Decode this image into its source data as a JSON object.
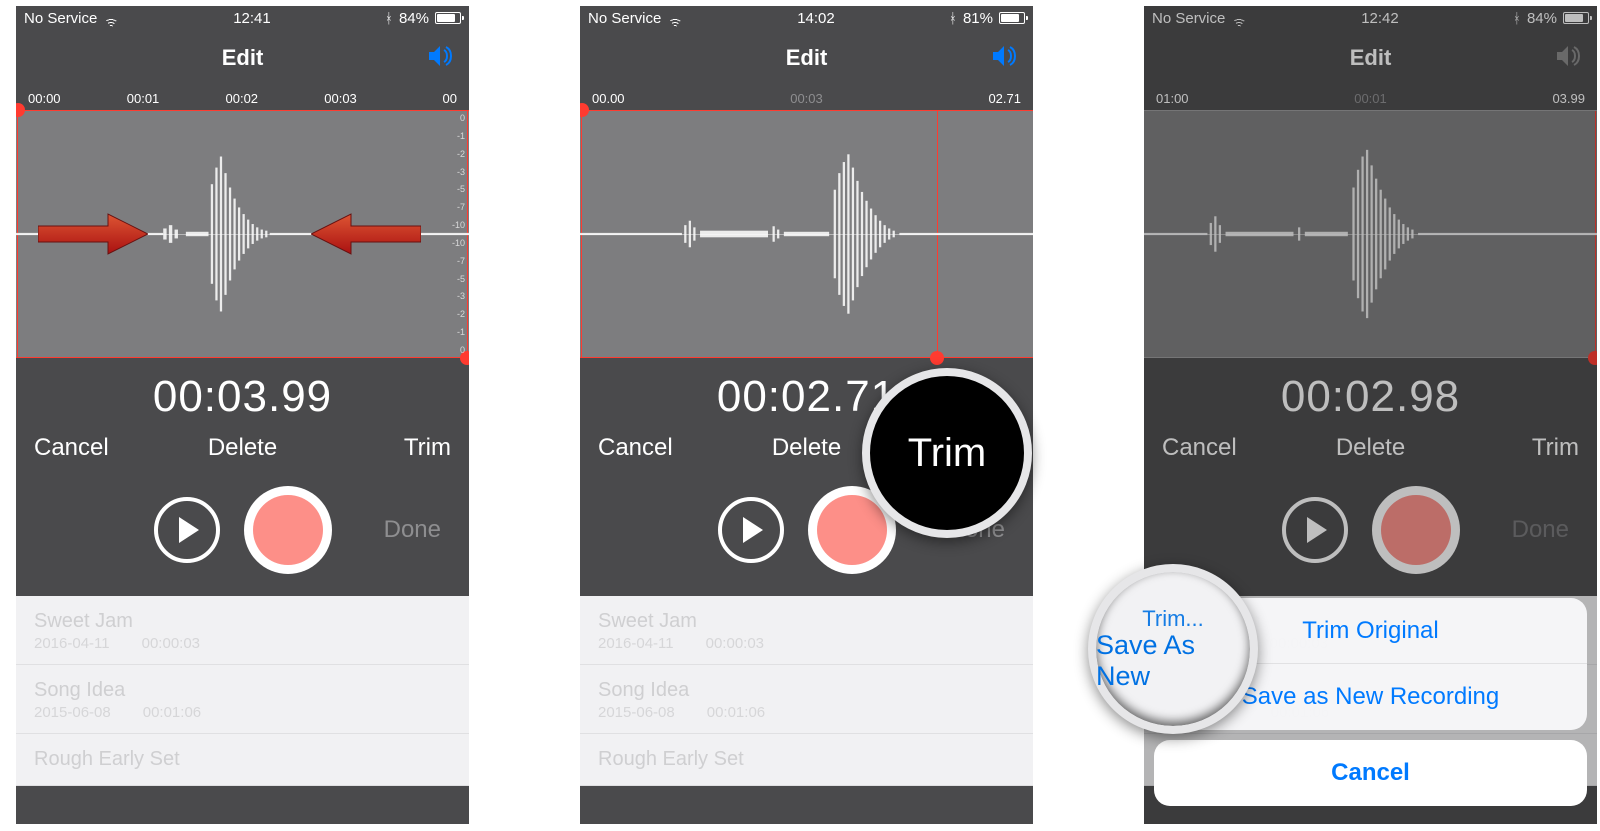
{
  "colors": {
    "ios_blue": "#007aff",
    "trim_red": "#ff3b30"
  },
  "db_scale": [
    "0",
    "-1",
    "-2",
    "-3",
    "-5",
    "-7",
    "-10",
    "-10",
    "-7",
    "-5",
    "-3",
    "-2",
    "-1",
    "0"
  ],
  "screens": [
    {
      "status": {
        "carrier": "No Service",
        "time": "12:41",
        "battery_pct": "84%",
        "battery_fill": 84
      },
      "nav": {
        "title": "Edit",
        "speaker_muted": false
      },
      "timeline": {
        "mode": "ruled",
        "marks": [
          "00:00",
          "00:01",
          "00:02",
          "00:03",
          "00"
        ]
      },
      "time_large": "00:03.99",
      "cdt": {
        "cancel": "Cancel",
        "delete": "Delete",
        "trim": "Trim"
      },
      "done": "Done",
      "list": [
        {
          "title": "Sweet Jam",
          "date": "2016-04-11",
          "dur": "00:00:03"
        },
        {
          "title": "Song Idea",
          "date": "2015-06-08",
          "dur": "00:01:06"
        },
        {
          "title": "Rough Early Set",
          "date": "",
          "dur": ""
        }
      ],
      "show_db": true,
      "arrows": true
    },
    {
      "status": {
        "carrier": "No Service",
        "time": "14:02",
        "battery_pct": "81%",
        "battery_fill": 81
      },
      "nav": {
        "title": "Edit",
        "speaker_muted": false
      },
      "timeline": {
        "mode": "triple",
        "marks": [
          "00.00",
          "00:03",
          "02.71"
        ]
      },
      "time_large": "00:02.71",
      "cdt": {
        "cancel": "Cancel",
        "delete": "Delete",
        "trim": "Trim"
      },
      "done": "Done",
      "list": [
        {
          "title": "Sweet Jam",
          "date": "2016-04-11",
          "dur": "00:00:03"
        },
        {
          "title": "Song Idea",
          "date": "2015-06-08",
          "dur": "00:01:06"
        },
        {
          "title": "Rough Early Set",
          "date": "",
          "dur": ""
        }
      ],
      "show_db": false,
      "magnifier": {
        "kind": "dark",
        "text": "Trim"
      }
    },
    {
      "status": {
        "carrier": "No Service",
        "time": "12:42",
        "battery_pct": "84%",
        "battery_fill": 84
      },
      "nav": {
        "title": "Edit",
        "speaker_muted": true
      },
      "timeline": {
        "mode": "triple",
        "marks": [
          "01:00",
          "00:01",
          "03.99"
        ]
      },
      "time_large": "00:02.98",
      "cdt": {
        "cancel": "Cancel",
        "delete": "Delete",
        "trim": "Trim"
      },
      "done": "Done",
      "list": [
        {
          "title": "Sweet Jam",
          "date": "2016-04-11",
          "dur": "00:00:03"
        },
        {
          "title": "Song Idea",
          "date": "2015-06-08",
          "dur": "00:01:06"
        },
        {
          "title": "Rough Early Set",
          "date": "",
          "dur": ""
        }
      ],
      "show_db": false,
      "sheet": {
        "trim_original": "Trim Original",
        "save_new": "Save as New Recording",
        "cancel": "Cancel"
      },
      "magnifier": {
        "kind": "light",
        "line1": "Trim...",
        "line2": "Save As New"
      }
    }
  ]
}
